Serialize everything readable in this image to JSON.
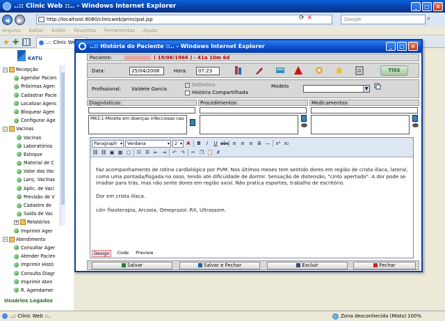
{
  "browser": {
    "title": "..:: Clinic Web ::.. - Windows Internet Explorer",
    "url": "http://localhost:8080/clinicweb/principal.jsp",
    "search_placeholder": "Google",
    "menu": [
      "Arquivo",
      "Editar",
      "Exibir",
      "Favoritos",
      "Ferramentas",
      "Ajuda"
    ],
    "tab_label": "..:: Clinic Web ::..",
    "status_text": "..:: Clinic Web ::..",
    "zone": "Zona desconhecida (Misto)",
    "zoom": "100%"
  },
  "app": {
    "logo_text": "KATU",
    "users_logged": "Usuários Logados",
    "tree": [
      {
        "level": 1,
        "type": "folder",
        "label": "Recepção"
      },
      {
        "level": 2,
        "type": "item",
        "label": "Agendar Pacien"
      },
      {
        "level": 2,
        "type": "item",
        "label": "Próximas Agen"
      },
      {
        "level": 2,
        "type": "item",
        "label": "Cadastrar Pacie"
      },
      {
        "level": 2,
        "type": "item",
        "label": "Localizar Agenc"
      },
      {
        "level": 2,
        "type": "item",
        "label": "Bloquear Agen"
      },
      {
        "level": 2,
        "type": "item",
        "label": "Configurar Age"
      },
      {
        "level": 1,
        "type": "folder",
        "label": "Vacinas"
      },
      {
        "level": 3,
        "type": "item",
        "label": "Vacinas"
      },
      {
        "level": 3,
        "type": "item",
        "label": "Laboratórios"
      },
      {
        "level": 3,
        "type": "item",
        "label": "Estoque"
      },
      {
        "level": 3,
        "type": "item",
        "label": "Material de C"
      },
      {
        "level": 3,
        "type": "item",
        "label": "Valor das Vac"
      },
      {
        "level": 3,
        "type": "item",
        "label": "Lanç. Vacinas"
      },
      {
        "level": 3,
        "type": "item",
        "label": "Aplic. de Vaci"
      },
      {
        "level": 3,
        "type": "item",
        "label": "Previsão de V"
      },
      {
        "level": 3,
        "type": "item",
        "label": "Cadastro de"
      },
      {
        "level": 3,
        "type": "item",
        "label": "Saída de Vac"
      },
      {
        "level": 2,
        "type": "folder",
        "label": "Relatórios"
      },
      {
        "level": 2,
        "type": "item",
        "label": "Imprimir Ager"
      },
      {
        "level": 1,
        "type": "folder",
        "label": "Atendimento"
      },
      {
        "level": 2,
        "type": "item",
        "label": "Consultar Ager"
      },
      {
        "level": 2,
        "type": "item",
        "label": "Atender Pacien"
      },
      {
        "level": 2,
        "type": "item",
        "label": "Imprimir Histó"
      },
      {
        "level": 2,
        "type": "item",
        "label": "Consulta Diagr"
      },
      {
        "level": 2,
        "type": "item",
        "label": "Imprimir Aten"
      },
      {
        "level": 2,
        "type": "item",
        "label": "R. Agendamer"
      }
    ]
  },
  "popup": {
    "title": "..:: História do Paciente ::.. - Windows Internet Explorer",
    "paciente_label": "Paciente:",
    "paciente_info": "( 19/06/1966 ) - 41a 10m 6d",
    "data_label": "Data:",
    "data_value": "25/04/2008",
    "hora_label": "Hora:",
    "hora_value": "07:23",
    "tiss_label": "TISS",
    "profissional_label": "Profissional:",
    "profissional_value": "Valdete Garcia",
    "definitivo_label": "Definitivo",
    "compartilhada_label": "História Compartilhada",
    "modelo_label": "Modelo",
    "diagnosticos_label": "Diagnósticos:",
    "procedimentos_label": "Procedimentos:",
    "medicamentos_label": "Medicamentos:",
    "diagnostico_item": "M63.1-Miosite em doenças infecciosas cau",
    "editor": {
      "format": "Paragraph",
      "font": "Verdana",
      "size": "2",
      "paragraphs": [
        "Faz acompanhamento de rotina cardiológico por PVM. Nos últimos meses tem sentido dores em região de crista ilíaca, lateral, como uma pontada/fisgada no osso, tendo até dificuldade de dormir. Sensação de distensão, \"cinto apertado\". A dor pode se irradiar para trás, mas não sente dores em região axial. Não pratica esportes, trabalho de escritório.",
        "Dor em crista ilíaca.",
        "cd= fisioterapia, Arcoxia, Omeprazol. RX, Ultrassom."
      ],
      "modes": [
        "Design",
        "Code",
        "Preview"
      ]
    },
    "buttons": {
      "salvar": "Salvar",
      "salvar_fechar": "Salvar e Fechar",
      "excluir": "Excluir",
      "fechar": "Fechar"
    }
  }
}
